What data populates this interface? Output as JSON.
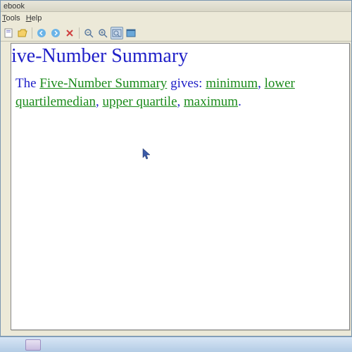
{
  "window": {
    "title": "ebook"
  },
  "menu": {
    "tools": "Tools",
    "help": "Help"
  },
  "toolbar_icons": {
    "page": "page-icon",
    "open": "open-icon",
    "back": "back-icon",
    "forward": "forward-icon",
    "delete": "delete-icon",
    "zoom_out": "zoom-out-icon",
    "zoom_in": "zoom-in-icon",
    "zoom_fit": "zoom-fit-icon",
    "fullscreen": "fullscreen-icon"
  },
  "content": {
    "heading": "ive-Number Summary",
    "line1_prefix": "The ",
    "term1": "Five-Number Summary",
    "line1_mid": " gives: ",
    "term2": "minimum",
    "sep1": ", ",
    "term3": "lower quartile",
    "term4": "median",
    "sep2": ", ",
    "term5": "upper quartile",
    "sep3": ", ",
    "term6": "maximum",
    "period": "."
  }
}
